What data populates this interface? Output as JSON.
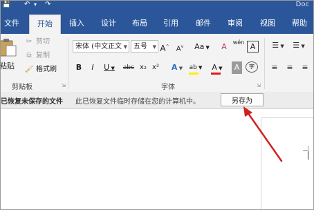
{
  "window": {
    "title_partial": "Doc"
  },
  "quick_access": {
    "save_icon": "save-icon",
    "undo_icon": "undo-icon"
  },
  "tabs": [
    {
      "label": "文件"
    },
    {
      "label": "开始"
    },
    {
      "label": "插入"
    },
    {
      "label": "设计"
    },
    {
      "label": "布局"
    },
    {
      "label": "引用"
    },
    {
      "label": "邮件"
    },
    {
      "label": "审阅"
    },
    {
      "label": "视图"
    },
    {
      "label": "帮助"
    }
  ],
  "clipboard": {
    "paste_label": "粘贴",
    "cut_label": "剪切",
    "copy_label": "复制",
    "format_painter_label": "格式刷",
    "group_label": "剪贴板"
  },
  "font": {
    "font_name": "宋体 (中文正文",
    "font_size": "五号",
    "grow_label": "A",
    "shrink_label": "A",
    "case_label": "Aa",
    "clear_format_label": "A",
    "phonetic_label": "wén",
    "border_label": "A",
    "bold_label": "B",
    "italic_label": "I",
    "underline_label": "U",
    "strike_label": "abc",
    "subscript_label": "x₂",
    "superscript_label": "x²",
    "effects_label": "A",
    "highlight_label": "ab",
    "color_label": "A",
    "shading_label": "A",
    "enclose_label": "字",
    "group_label": "字体",
    "highlight_color": "#ffee00",
    "font_color": "#d91c1c"
  },
  "notification": {
    "title": "已恢复未保存的文件",
    "message": "此已恢复文件临时存储在您的计算机中。",
    "save_as_label": "另存为"
  },
  "colors": {
    "ribbon_blue": "#2b579a",
    "arrow_red": "#d22020"
  }
}
